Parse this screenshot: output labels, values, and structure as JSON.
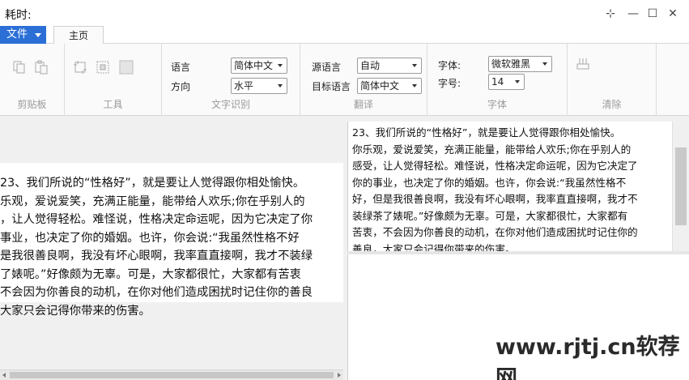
{
  "window": {
    "title": "耗时:",
    "pin_label": "⊹",
    "minimize_label": "—",
    "maximize_label": "☐",
    "close_label": "✕"
  },
  "menu": {
    "file_label": "文件",
    "tab_home": "主页"
  },
  "ribbon": {
    "clipboard": {
      "label": "剪贴板"
    },
    "tools": {
      "label": "工具"
    },
    "ocr": {
      "label": "文字识别",
      "language_label": "语言",
      "language_value": "简体中文",
      "direction_label": "方向",
      "direction_value": "水平"
    },
    "translate": {
      "label": "翻译",
      "source_label": "源语言",
      "source_value": "自动",
      "target_label": "目标语言",
      "target_value": "简体中文"
    },
    "font": {
      "label": "字体",
      "font_label": "字体:",
      "font_value": "微软雅黑",
      "size_label": "字号:",
      "size_value": "14"
    },
    "clear": {
      "label": "清除"
    }
  },
  "left_text": "23、我们所说的“性格好”，就是要让人觉得跟你相处愉快。\n乐观，爱说爱笑，充满正能量，能带给人欢乐;你在乎别人的\n，让人觉得轻松。难怪说，性格决定命运呢，因为它决定了你\n事业，也决定了你的婚姻。也许，你会说:“我虽然性格不好\n是我很善良啊，我没有坏心眼啊，我率直直接啊，我才不装绿\n了婊呢。”好像颇为无辜。可是，大家都很忙，大家都有苦衷\n不会因为你善良的动机，在你对他们造成困扰时记住你的善良\n大家只会记得你带来的伤害。",
  "right_text": "23、我们所说的“性格好”，就是要让人觉得跟你相处愉快。\n你乐观，爱说爱笑，充满正能量，能带给人欢乐;你在乎别人的\n感受，让人觉得轻松。难怪说，性格决定命运呢，因为它决定了\n你的事业，也决定了你的婚姻。也许，你会说:“我虽然性格不\n好，但是我很善良啊，我没有坏心眼啊，我率直直接啊，我才不\n装绿茶了婊呢。”好像颇为无辜。可是，大家都很忙，大家都有\n苦衷，不会因为你善良的动机，在你对他们造成困扰时记住你的\n善良，大家只会记得你带来的伤害。",
  "watermark": "www.rjtj.cn软荐网"
}
